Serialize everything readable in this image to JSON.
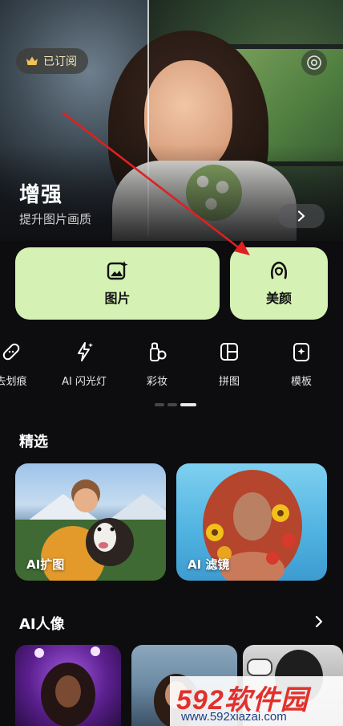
{
  "hero": {
    "subscription_badge": "已订阅",
    "title": "增强",
    "subtitle": "提升图片画质"
  },
  "main_buttons": [
    {
      "label": "图片",
      "icon": "image-sparkle-icon"
    },
    {
      "label": "美颜",
      "icon": "face-icon"
    }
  ],
  "tools": [
    {
      "label": "去划痕",
      "icon": "bandage-icon"
    },
    {
      "label": "AI 闪光灯",
      "icon": "flash-icon"
    },
    {
      "label": "彩妆",
      "icon": "makeup-icon"
    },
    {
      "label": "拼图",
      "icon": "collage-icon"
    },
    {
      "label": "模板",
      "icon": "template-icon"
    }
  ],
  "featured": {
    "title": "精选",
    "cards": [
      {
        "label": "AI扩图"
      },
      {
        "label": "AI 滤镜"
      }
    ]
  },
  "portrait": {
    "title": "AI人像"
  },
  "watermark": {
    "main": "592软件园",
    "url": "www.592xiazai.com"
  },
  "colors": {
    "accent_green": "#d5f2b4",
    "background": "#0d0d0f",
    "annotation_arrow": "#e02020"
  }
}
